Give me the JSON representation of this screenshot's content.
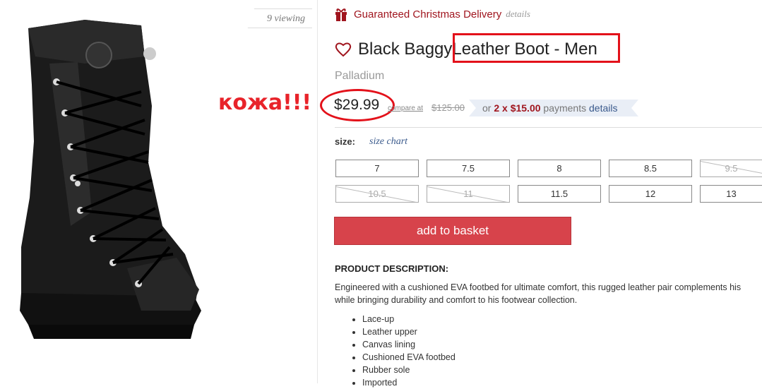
{
  "viewing": "9 viewing",
  "annotation": "кожа!!!",
  "delivery": {
    "label": "Guaranteed Christmas Delivery",
    "details": "details"
  },
  "product": {
    "title_part1": "Black Baggy ",
    "title_part2": "Leather Boot - Men",
    "brand": "Palladium",
    "price": "$29.99",
    "compare_label": "compare at",
    "compare_price": "$125.00",
    "payments": {
      "prefix": "or",
      "amount": "2 x $15.00",
      "suffix": "payments",
      "details": "details"
    }
  },
  "sizes": {
    "label": "size:",
    "chart_link": "size chart",
    "row1": [
      {
        "value": "7",
        "available": true
      },
      {
        "value": "7.5",
        "available": true
      },
      {
        "value": "8",
        "available": true
      },
      {
        "value": "8.5",
        "available": true
      },
      {
        "value": "9.5",
        "available": false
      }
    ],
    "row2": [
      {
        "value": "10.5",
        "available": false
      },
      {
        "value": "11",
        "available": false
      },
      {
        "value": "11.5",
        "available": true
      },
      {
        "value": "12",
        "available": true
      },
      {
        "value": "13",
        "available": true
      }
    ]
  },
  "add_to_basket": "add to basket",
  "description": {
    "heading": "PRODUCT DESCRIPTION:",
    "line1": "Engineered with a cushioned EVA footbed for ultimate comfort, this rugged leather pair complements his",
    "line2": "while bringing durability and comfort to his footwear collection.",
    "features": [
      "Lace-up",
      "Leather upper",
      "Canvas lining",
      "Cushioned EVA footbed",
      "Rubber sole",
      "Imported"
    ]
  },
  "colors": {
    "accent_red": "#d7434b",
    "brand_red": "#a0151e",
    "annotation_red": "#e3111a"
  }
}
